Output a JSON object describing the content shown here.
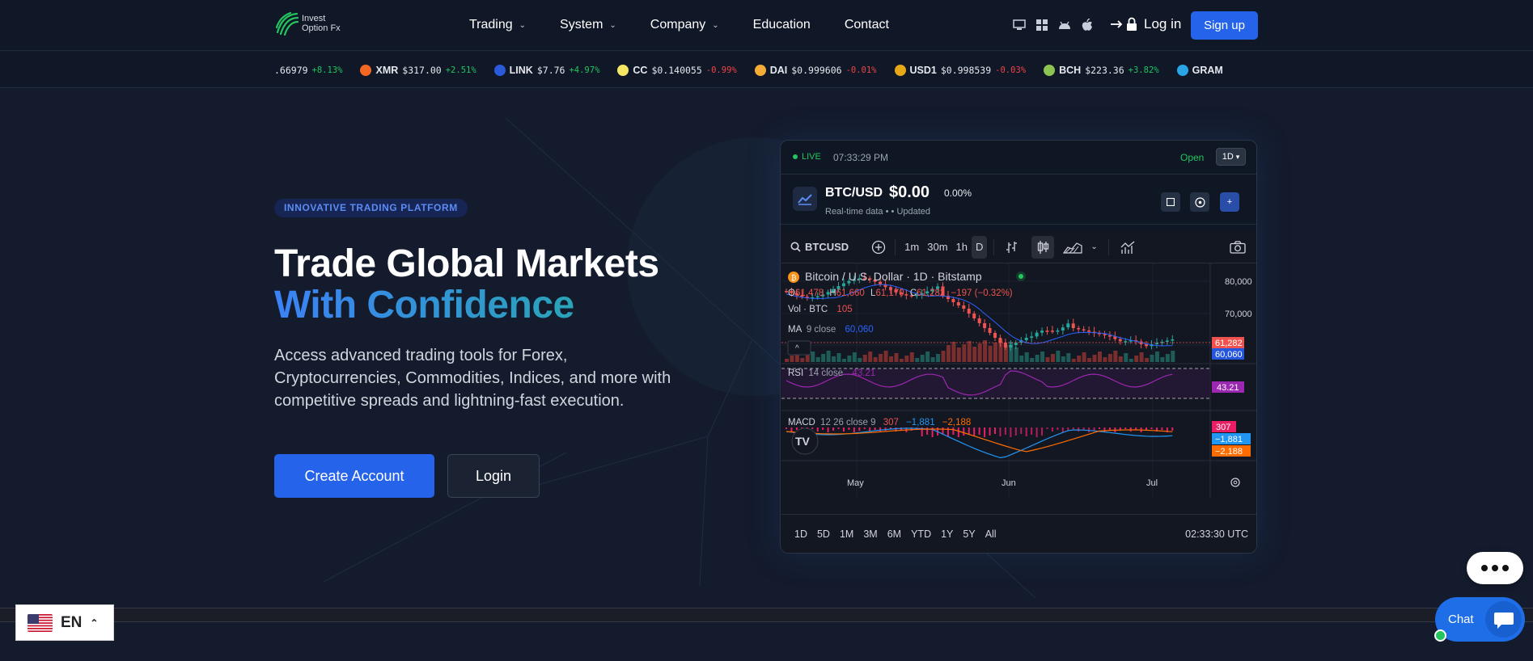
{
  "brand": {
    "name_line1": "Invest",
    "name_line2": "Option Fx"
  },
  "nav": {
    "items": [
      {
        "label": "Trading",
        "has_dropdown": true
      },
      {
        "label": "System",
        "has_dropdown": true
      },
      {
        "label": "Company",
        "has_dropdown": true
      },
      {
        "label": "Education",
        "has_dropdown": false
      },
      {
        "label": "Contact",
        "has_dropdown": false
      }
    ],
    "platform_icons": [
      "desktop-icon",
      "windows-icon",
      "android-icon",
      "apple-icon"
    ],
    "login_label": "Log in",
    "signup_label": "Sign up"
  },
  "ticker": [
    {
      "symbol": "",
      "price": ".66979",
      "change": "+8.13%",
      "direction": "up",
      "icon_color": ""
    },
    {
      "symbol": "XMR",
      "price": "$317.00",
      "change": "+2.51%",
      "direction": "up",
      "icon_color": "#f26822"
    },
    {
      "symbol": "LINK",
      "price": "$7.76",
      "change": "+4.97%",
      "direction": "up",
      "icon_color": "#2a5ada"
    },
    {
      "symbol": "CC",
      "price": "$0.140055",
      "change": "-0.99%",
      "direction": "down",
      "icon_color": "#f5e663"
    },
    {
      "symbol": "DAI",
      "price": "$0.999606",
      "change": "-0.01%",
      "direction": "down",
      "icon_color": "#f5ac37"
    },
    {
      "symbol": "USD1",
      "price": "$0.998539",
      "change": "-0.03%",
      "direction": "down",
      "icon_color": "#e6a817"
    },
    {
      "symbol": "BCH",
      "price": "$223.36",
      "change": "+3.82%",
      "direction": "up",
      "icon_color": "#8dc351"
    },
    {
      "symbol": "GRAM",
      "price": "",
      "change": "",
      "direction": "up",
      "icon_color": "#2aa5e8"
    }
  ],
  "hero": {
    "badge": "INNOVATIVE TRADING PLATFORM",
    "title_line1": "Trade Global Markets",
    "title_line2": "With Confidence",
    "description": "Access advanced trading tools for Forex, Cryptocurrencies, Commodities, Indices, and more with competitive spreads and lightning-fast execution.",
    "cta_primary": "Create Account",
    "cta_secondary": "Login"
  },
  "widget": {
    "live_label": "LIVE",
    "time": "07:33:29 PM",
    "status": "Open",
    "timeframe": "1D",
    "symbol": "BTC/USD",
    "price": "$0.00",
    "change_pct": "0.00%",
    "sub_realtime": "Real-time data",
    "sub_updated": "Updated",
    "chart": {
      "symbol_search": "BTCUSD",
      "intervals": [
        "1m",
        "30m",
        "1h",
        "D"
      ],
      "active_interval": "D",
      "legend_title": "Bitcoin / U.S. Dollar · 1D · Bitstamp",
      "ohlc": {
        "o": "61,478",
        "h": "61,660",
        "l": "61,170",
        "c": "61,282",
        "chg": "−197 (−0.32%)"
      },
      "vol_label": "Vol · BTC",
      "vol_value": "105",
      "ma_label": "MA",
      "ma_params": "9 close",
      "ma_value": "60,060",
      "rsi_label": "RSI",
      "rsi_params": "14 close",
      "rsi_value": "43.21",
      "macd_label": "MACD",
      "macd_params": "12 26 close 9",
      "macd_values": [
        "307",
        "−1,881",
        "−2,188"
      ],
      "price_axis": [
        "80,000",
        "70,000"
      ],
      "price_tags": {
        "last": "61,282",
        "ma": "60,060",
        "rsi": "43.21",
        "macd_hist": "307",
        "macd_line": "−1,881",
        "macd_signal": "−2,188"
      },
      "time_axis": [
        "May",
        "Jun",
        "Jul"
      ],
      "ranges": [
        "1D",
        "5D",
        "1M",
        "3M",
        "6M",
        "YTD",
        "1Y",
        "5Y",
        "All"
      ],
      "clock": "02:33:30 UTC"
    }
  },
  "language": {
    "code": "EN"
  },
  "chat": {
    "label": "Chat"
  },
  "colors": {
    "accent": "#2563eb",
    "up": "#22c55e",
    "down": "#ef4444",
    "rsi": "#9c27b0",
    "macd": "#2196f3",
    "signal": "#ff6d00"
  }
}
